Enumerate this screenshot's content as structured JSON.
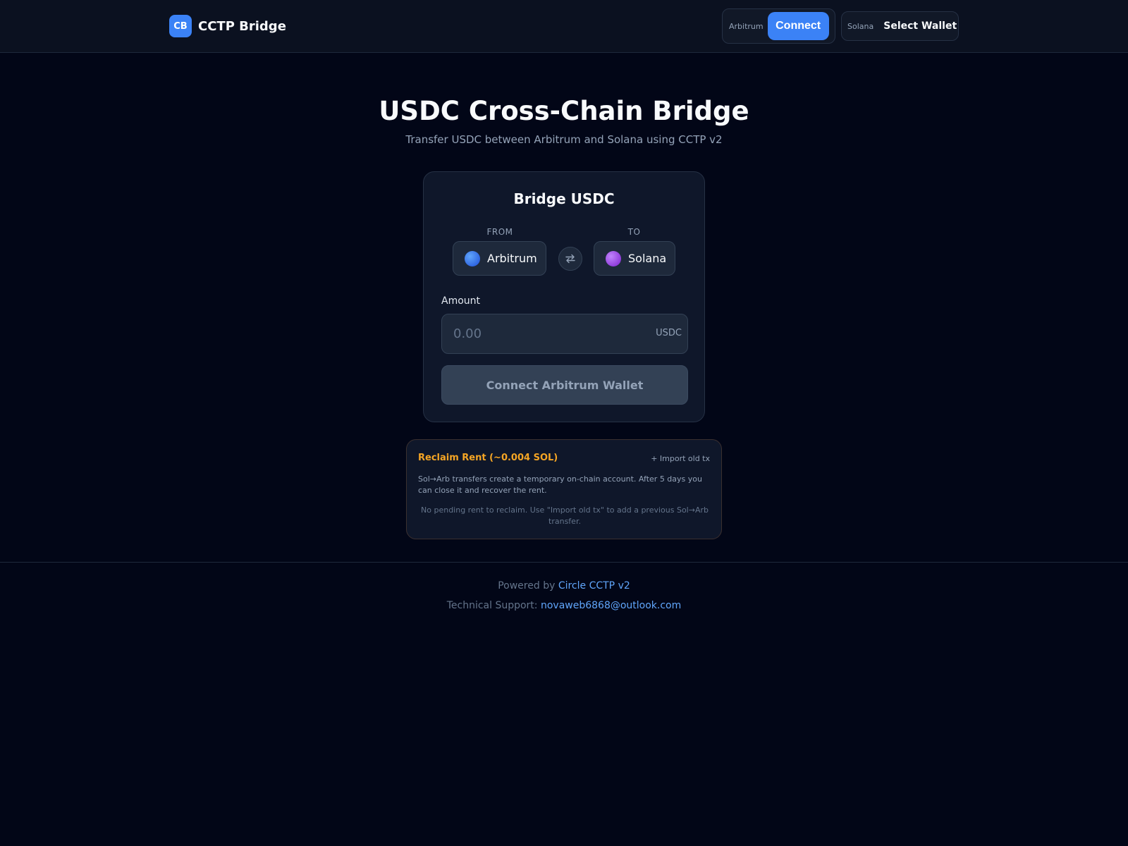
{
  "header": {
    "logo_text": "CB",
    "app_name": "CCTP Bridge",
    "arbitrum_wallet": {
      "chain_label": "Arbitrum",
      "button_label": "Connect"
    },
    "solana_wallet": {
      "chain_label": "Solana",
      "button_label": "Select Wallet"
    }
  },
  "hero": {
    "title": "USDC Cross-Chain Bridge",
    "subtitle": "Transfer USDC between Arbitrum and Solana using CCTP v2"
  },
  "bridge_card": {
    "title": "Bridge USDC",
    "from_label": "FROM",
    "to_label": "TO",
    "from_chain": {
      "name": "Arbitrum",
      "icon": "blue-circle-icon",
      "color": "#3b82f6"
    },
    "to_chain": {
      "name": "Solana",
      "icon": "purple-circle-icon",
      "color": "#a855f7"
    },
    "swap_icon": "swap-arrows-icon",
    "amount_label": "Amount",
    "amount_placeholder": "0.00",
    "amount_value": "",
    "amount_unit": "USDC",
    "submit_label": "Connect Arbitrum Wallet"
  },
  "reclaim": {
    "title": "Reclaim Rent (~0.004 SOL)",
    "import_label": "+ Import old tx",
    "description": "Sol→Arb transfers create a temporary on-chain account. After 5 days you can close it and recover the rent.",
    "empty_message": "No pending rent to reclaim. Use \"Import old tx\" to add a previous Sol→Arb transfer."
  },
  "footer": {
    "powered_prefix": "Powered by ",
    "powered_link": "Circle CCTP v2",
    "support_prefix": "Technical Support: ",
    "support_email": "novaweb6868@outlook.com"
  },
  "colors": {
    "accent": "#3b82f6",
    "background": "#020617",
    "warning": "#f5a524",
    "link": "#60a5fa"
  }
}
